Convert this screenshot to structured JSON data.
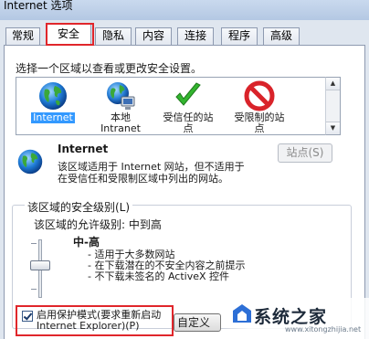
{
  "window": {
    "title": "Internet 选项"
  },
  "tabs": [
    {
      "label": "常规"
    },
    {
      "label": "安全"
    },
    {
      "label": "隐私"
    },
    {
      "label": "内容"
    },
    {
      "label": "连接"
    },
    {
      "label": "程序"
    },
    {
      "label": "高级"
    }
  ],
  "active_tab": "安全",
  "security": {
    "instruction": "选择一个区域以查看或更改安全设置。",
    "zones": [
      {
        "label": "Internet",
        "icon": "globe-icon",
        "selected": true
      },
      {
        "label": "本地\nIntranet",
        "icon": "intranet-globe-icon"
      },
      {
        "label": "受信任的站\n点",
        "icon": "green-check-icon"
      },
      {
        "label": "受限制的站\n点",
        "icon": "red-prohibited-icon"
      }
    ],
    "selected_zone": {
      "name": "Internet",
      "description_line1": "该区域适用于 Internet 网站，但不适用于",
      "description_line2": "在受信任和受限制区域中列出的网站。",
      "sites_button": "站点(S)"
    },
    "level_group": {
      "legend": "该区域的安全级别(L)",
      "allowed": "该区域的允许级别: 中到高",
      "level_name": "中-高",
      "bullets": [
        "- 适用于大多数网站",
        "- 在下载潜在的不安全内容之前提示",
        "- 不下载未签名的 ActiveX 控件"
      ],
      "level_value": "中-高"
    },
    "protected_mode": {
      "line1": "启用保护模式(要求重新启动",
      "line2": "Internet Explorer)(P)",
      "checked": true
    },
    "custom_button": "自定义级别(C)..."
  },
  "watermark": {
    "text": "系统之家",
    "url": "www.xitongzhijia.net"
  },
  "colors": {
    "highlight_box": "#e0262b",
    "selection": "#3399ff"
  }
}
